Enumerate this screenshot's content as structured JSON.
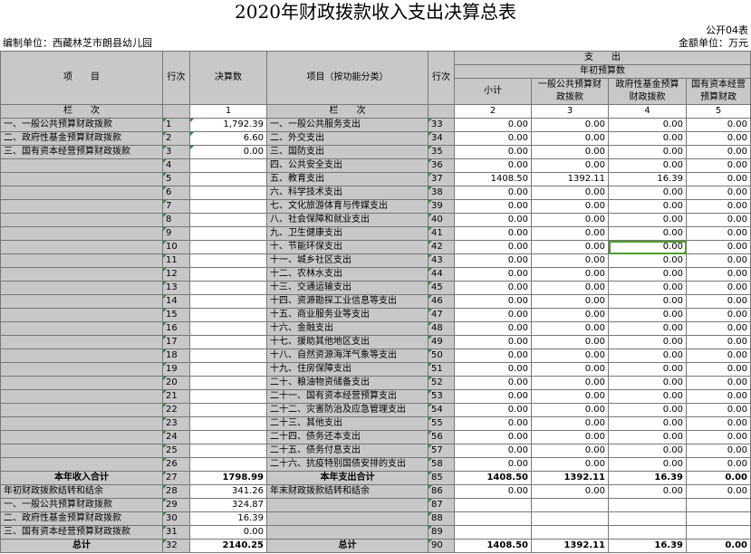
{
  "title": "2020年财政拨款收入支出决算总表",
  "form_code": "公开04表",
  "unit_label": "编制单位：西藏林芝市朗县幼儿园",
  "currency_label": "金额单位：万元",
  "headers": {
    "income_item": "项　　目",
    "row_no": "行次",
    "budget_amount": "决算数",
    "expense": "支　　出",
    "expense_item": "项目（按功能分类）",
    "annual_budget": "年初预算数",
    "subtotal": "小计",
    "general_budget": "一般公共预算财政拨款",
    "fund_budget": "政府性基金预算财政拨款",
    "state_capital": "国有资本经营预算财政",
    "col_label": "栏　　次",
    "col_1": "1",
    "col_2": "2",
    "col_3": "3",
    "col_4": "4",
    "col_5": "5"
  },
  "rows": [
    {
      "left_item": "一、一般公共预算财政拨款",
      "left_no": "1",
      "left_amt": "1,792.39",
      "right_item": "一、一般公共服务支出",
      "right_no": "33",
      "v1": "0.00",
      "v2": "0.00",
      "v3": "0.00",
      "v4": "0.00"
    },
    {
      "left_item": "二、政府性基金预算财政拨款",
      "left_no": "2",
      "left_amt": "6.60",
      "right_item": "二、外交支出",
      "right_no": "34",
      "v1": "0.00",
      "v2": "0.00",
      "v3": "0.00",
      "v4": "0.00"
    },
    {
      "left_item": "三、国有资本经营预算财政拨款",
      "left_no": "3",
      "left_amt": "0.00",
      "right_item": "三、国防支出",
      "right_no": "35",
      "v1": "0.00",
      "v2": "0.00",
      "v3": "0.00",
      "v4": "0.00"
    },
    {
      "left_item": "",
      "left_no": "4",
      "left_amt": "",
      "right_item": "四、公共安全支出",
      "right_no": "36",
      "v1": "0.00",
      "v2": "0.00",
      "v3": "0.00",
      "v4": "0.00"
    },
    {
      "left_item": "",
      "left_no": "5",
      "left_amt": "",
      "right_item": "五、教育支出",
      "right_no": "37",
      "v1": "1408.50",
      "v2": "1392.11",
      "v3": "16.39",
      "v4": "0.00"
    },
    {
      "left_item": "",
      "left_no": "6",
      "left_amt": "",
      "right_item": "六、科学技术支出",
      "right_no": "38",
      "v1": "0.00",
      "v2": "0.00",
      "v3": "0.00",
      "v4": "0.00"
    },
    {
      "left_item": "",
      "left_no": "7",
      "left_amt": "",
      "right_item": "七、文化旅游体育与传媒支出",
      "right_no": "39",
      "v1": "0.00",
      "v2": "0.00",
      "v3": "0.00",
      "v4": "0.00"
    },
    {
      "left_item": "",
      "left_no": "8",
      "left_amt": "",
      "right_item": "八、社会保障和就业支出",
      "right_no": "40",
      "v1": "0.00",
      "v2": "0.00",
      "v3": "0.00",
      "v4": "0.00"
    },
    {
      "left_item": "",
      "left_no": "9",
      "left_amt": "",
      "right_item": "九、卫生健康支出",
      "right_no": "41",
      "v1": "0.00",
      "v2": "0.00",
      "v3": "0.00",
      "v4": "0.00"
    },
    {
      "left_item": "",
      "left_no": "10",
      "left_amt": "",
      "right_item": "十、节能环保支出",
      "right_no": "42",
      "v1": "0.00",
      "v2": "0.00",
      "v3": "0.00",
      "v4": "0.00"
    },
    {
      "left_item": "",
      "left_no": "11",
      "left_amt": "",
      "right_item": "十一、城乡社区支出",
      "right_no": "43",
      "v1": "0.00",
      "v2": "0.00",
      "v3": "0.00",
      "v4": "0.00"
    },
    {
      "left_item": "",
      "left_no": "12",
      "left_amt": "",
      "right_item": "十二、农林水支出",
      "right_no": "44",
      "v1": "0.00",
      "v2": "0.00",
      "v3": "0.00",
      "v4": "0.00"
    },
    {
      "left_item": "",
      "left_no": "13",
      "left_amt": "",
      "right_item": "十三、交通运输支出",
      "right_no": "45",
      "v1": "0.00",
      "v2": "0.00",
      "v3": "0.00",
      "v4": "0.00"
    },
    {
      "left_item": "",
      "left_no": "14",
      "left_amt": "",
      "right_item": "十四、资源勘探工业信息等支出",
      "right_no": "46",
      "v1": "0.00",
      "v2": "0.00",
      "v3": "0.00",
      "v4": "0.00"
    },
    {
      "left_item": "",
      "left_no": "15",
      "left_amt": "",
      "right_item": "十五、商业服务业等支出",
      "right_no": "47",
      "v1": "0.00",
      "v2": "0.00",
      "v3": "0.00",
      "v4": "0.00"
    },
    {
      "left_item": "",
      "left_no": "16",
      "left_amt": "",
      "right_item": "十六、金融支出",
      "right_no": "48",
      "v1": "0.00",
      "v2": "0.00",
      "v3": "0.00",
      "v4": "0.00"
    },
    {
      "left_item": "",
      "left_no": "17",
      "left_amt": "",
      "right_item": "十七、援助其他地区支出",
      "right_no": "49",
      "v1": "0.00",
      "v2": "0.00",
      "v3": "0.00",
      "v4": "0.00"
    },
    {
      "left_item": "",
      "left_no": "18",
      "left_amt": "",
      "right_item": "十八、自然资源海洋气象等支出",
      "right_no": "50",
      "v1": "0.00",
      "v2": "0.00",
      "v3": "0.00",
      "v4": "0.00"
    },
    {
      "left_item": "",
      "left_no": "19",
      "left_amt": "",
      "right_item": "十九、住房保障支出",
      "right_no": "51",
      "v1": "0.00",
      "v2": "0.00",
      "v3": "0.00",
      "v4": "0.00"
    },
    {
      "left_item": "",
      "left_no": "20",
      "left_amt": "",
      "right_item": "二十、粮油物资储备支出",
      "right_no": "52",
      "v1": "0.00",
      "v2": "0.00",
      "v3": "0.00",
      "v4": "0.00"
    },
    {
      "left_item": "",
      "left_no": "21",
      "left_amt": "",
      "right_item": "二十一、国有资本经营预算支出",
      "right_no": "53",
      "v1": "0.00",
      "v2": "0.00",
      "v3": "0.00",
      "v4": "0.00"
    },
    {
      "left_item": "",
      "left_no": "22",
      "left_amt": "",
      "right_item": "二十二、灾害防治及应急管理支出",
      "right_no": "54",
      "v1": "0.00",
      "v2": "0.00",
      "v3": "0.00",
      "v4": "0.00"
    },
    {
      "left_item": "",
      "left_no": "23",
      "left_amt": "",
      "right_item": "二十三、其他支出",
      "right_no": "55",
      "v1": "0.00",
      "v2": "0.00",
      "v3": "0.00",
      "v4": "0.00"
    },
    {
      "left_item": "",
      "left_no": "24",
      "left_amt": "",
      "right_item": "二十四、债务还本支出",
      "right_no": "56",
      "v1": "0.00",
      "v2": "0.00",
      "v3": "0.00",
      "v4": "0.00"
    },
    {
      "left_item": "",
      "left_no": "25",
      "left_amt": "",
      "right_item": "二十五、债务付息支出",
      "right_no": "57",
      "v1": "0.00",
      "v2": "0.00",
      "v3": "0.00",
      "v4": "0.00"
    },
    {
      "left_item": "",
      "left_no": "26",
      "left_amt": "",
      "right_item": "二十六、抗疫特别国债安排的支出",
      "right_no": "58",
      "v1": "0.00",
      "v2": "0.00",
      "v3": "0.00",
      "v4": "0.00"
    }
  ],
  "totals": {
    "income_total_label": "本年收入合计",
    "income_total_no": "27",
    "income_total_amt": "1798.99",
    "expense_total_label": "本年支出合计",
    "expense_total_no": "85",
    "expense_total_v1": "1408.50",
    "expense_total_v2": "1392.11",
    "expense_total_v3": "16.39",
    "expense_total_v4": "0.00",
    "carry_in_label": "年初财政拨款结转和结余",
    "carry_in_no": "28",
    "carry_in_amt": "341.26",
    "carry_out_label": "年末财政拨款结转和结余",
    "carry_out_no": "86",
    "carry_out_v1": "0.00",
    "carry_out_v2": "0.00",
    "carry_out_v3": "0.00",
    "carry_out_v4": "0.00",
    "ci_general_label": "一、一般公共预算财政拨款",
    "ci_general_no": "29",
    "ci_general_amt": "324.87",
    "ci_blank1_no": "87",
    "ci_fund_label": "二、政府性基金预算财政拨款",
    "ci_fund_no": "30",
    "ci_fund_amt": "16.39",
    "ci_blank2_no": "88",
    "ci_state_label": "三、国有资本经营预算财政拨款",
    "ci_state_no": "31",
    "ci_state_amt": "0.00",
    "ci_blank3_no": "89",
    "grand_label_left": "总计",
    "grand_no_left": "32",
    "grand_amt_left": "2140.25",
    "grand_label_right": "总计",
    "grand_no_right": "90",
    "grand_v1": "1408.50",
    "grand_v2": "1392.11",
    "grand_v3": "16.39",
    "grand_v4": "0.00"
  }
}
